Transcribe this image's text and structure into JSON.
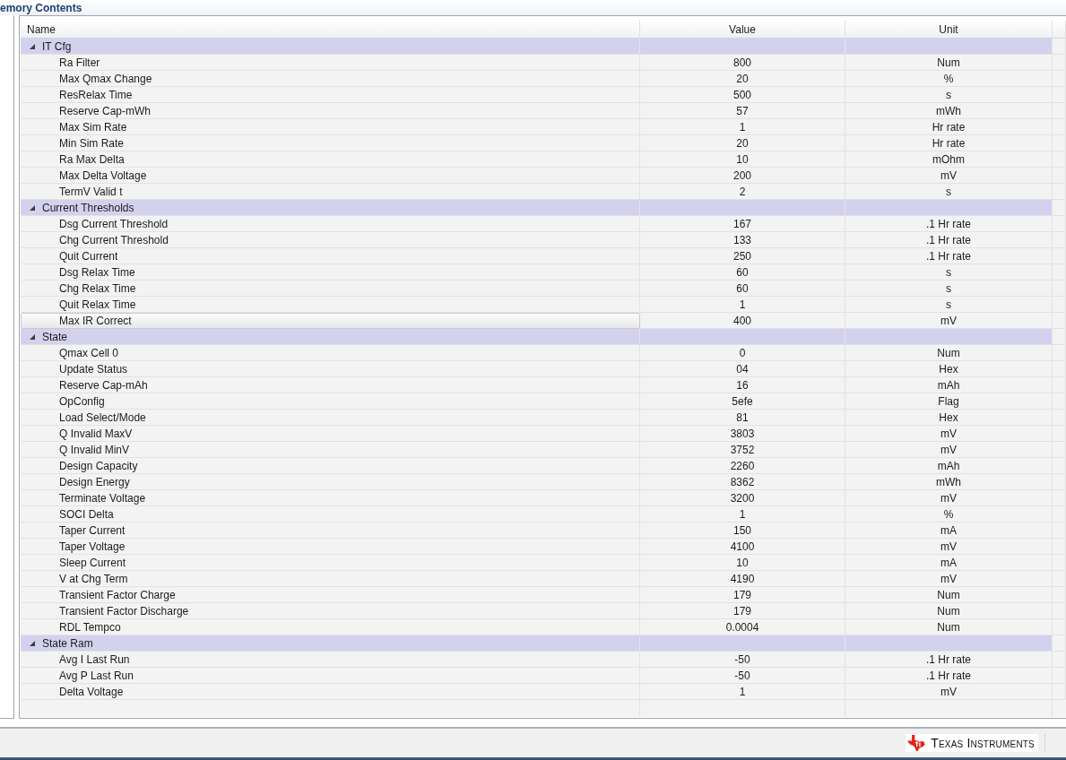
{
  "window": {
    "title": "emory Contents"
  },
  "table": {
    "columns": [
      "Name",
      "Value",
      "Unit"
    ],
    "groups": [
      {
        "name": "IT Cfg",
        "expanded": true,
        "rows": [
          {
            "name": "Ra Filter",
            "value": "800",
            "unit": "Num",
            "selected": false
          },
          {
            "name": "Max Qmax Change",
            "value": "20",
            "unit": "%",
            "selected": false
          },
          {
            "name": "ResRelax Time",
            "value": "500",
            "unit": "s",
            "selected": false
          },
          {
            "name": "Reserve Cap-mWh",
            "value": "57",
            "unit": "mWh",
            "selected": false
          },
          {
            "name": "Max Sim Rate",
            "value": "1",
            "unit": "Hr rate",
            "selected": false
          },
          {
            "name": "Min Sim Rate",
            "value": "20",
            "unit": "Hr rate",
            "selected": false
          },
          {
            "name": "Ra Max Delta",
            "value": "10",
            "unit": "mOhm",
            "selected": false
          },
          {
            "name": "Max Delta Voltage",
            "value": "200",
            "unit": "mV",
            "selected": false
          },
          {
            "name": "TermV Valid t",
            "value": "2",
            "unit": "s",
            "selected": false
          }
        ]
      },
      {
        "name": "Current Thresholds",
        "expanded": true,
        "rows": [
          {
            "name": "Dsg Current Threshold",
            "value": "167",
            "unit": ".1 Hr rate",
            "selected": false
          },
          {
            "name": "Chg Current Threshold",
            "value": "133",
            "unit": ".1 Hr rate",
            "selected": false
          },
          {
            "name": "Quit Current",
            "value": "250",
            "unit": ".1 Hr rate",
            "selected": false
          },
          {
            "name": "Dsg Relax Time",
            "value": "60",
            "unit": "s",
            "selected": false
          },
          {
            "name": "Chg Relax Time",
            "value": "60",
            "unit": "s",
            "selected": false
          },
          {
            "name": "Quit Relax Time",
            "value": "1",
            "unit": "s",
            "selected": false
          },
          {
            "name": "Max IR Correct",
            "value": "400",
            "unit": "mV",
            "selected": true
          }
        ]
      },
      {
        "name": "State",
        "expanded": true,
        "rows": [
          {
            "name": "Qmax Cell 0",
            "value": "0",
            "unit": "Num",
            "selected": false
          },
          {
            "name": "Update Status",
            "value": "04",
            "unit": "Hex",
            "selected": false
          },
          {
            "name": "Reserve Cap-mAh",
            "value": "16",
            "unit": "mAh",
            "selected": false
          },
          {
            "name": "OpConfig",
            "value": "5efe",
            "unit": "Flag",
            "selected": false
          },
          {
            "name": "Load Select/Mode",
            "value": "81",
            "unit": "Hex",
            "selected": false
          },
          {
            "name": "Q Invalid MaxV",
            "value": "3803",
            "unit": "mV",
            "selected": false
          },
          {
            "name": "Q Invalid MinV",
            "value": "3752",
            "unit": "mV",
            "selected": false
          },
          {
            "name": "Design Capacity",
            "value": "2260",
            "unit": "mAh",
            "selected": false
          },
          {
            "name": "Design Energy",
            "value": "8362",
            "unit": "mWh",
            "selected": false
          },
          {
            "name": "Terminate Voltage",
            "value": "3200",
            "unit": "mV",
            "selected": false
          },
          {
            "name": "SOCI Delta",
            "value": "1",
            "unit": "%",
            "selected": false
          },
          {
            "name": "Taper Current",
            "value": "150",
            "unit": "mA",
            "selected": false
          },
          {
            "name": "Taper Voltage",
            "value": "4100",
            "unit": "mV",
            "selected": false
          },
          {
            "name": "Sleep Current",
            "value": "10",
            "unit": "mA",
            "selected": false
          },
          {
            "name": "V at Chg Term",
            "value": "4190",
            "unit": "mV",
            "selected": false
          },
          {
            "name": "Transient Factor Charge",
            "value": "179",
            "unit": "Num",
            "selected": false
          },
          {
            "name": "Transient Factor Discharge",
            "value": "179",
            "unit": "Num",
            "selected": false
          },
          {
            "name": "RDL Tempco",
            "value": "0.0004",
            "unit": "Num",
            "selected": false
          }
        ]
      },
      {
        "name": "State Ram",
        "expanded": true,
        "rows": [
          {
            "name": "Avg I Last Run",
            "value": "-50",
            "unit": ".1 Hr rate",
            "selected": false
          },
          {
            "name": "Avg P Last Run",
            "value": "-50",
            "unit": ".1 Hr rate",
            "selected": false
          },
          {
            "name": "Delta Voltage",
            "value": "1",
            "unit": "mV",
            "selected": false
          }
        ]
      }
    ]
  },
  "status_bar": {
    "logo": "Texas Instruments"
  }
}
